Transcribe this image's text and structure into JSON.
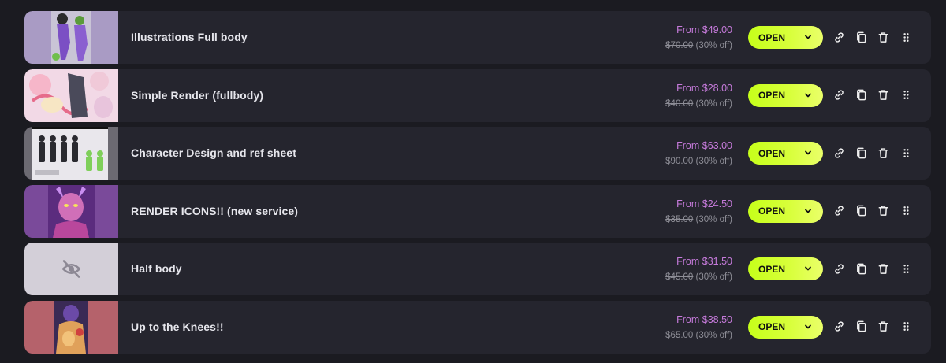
{
  "services": [
    {
      "title": "Illustrations Full body",
      "price_from": "From $49.00",
      "price_original": "$70.00",
      "discount": "(30% off)",
      "status": "OPEN",
      "thumbnail": "illustration-fullbody",
      "thumb_bg": "#a99bc4"
    },
    {
      "title": "Simple Render (fullbody)",
      "price_from": "From $28.00",
      "price_original": "$40.00",
      "discount": "(30% off)",
      "status": "OPEN",
      "thumbnail": "simple-render",
      "thumb_bg": "#f2d9e6"
    },
    {
      "title": "Character Design and ref sheet",
      "price_from": "From $63.00",
      "price_original": "$90.00",
      "discount": "(30% off)",
      "status": "OPEN",
      "thumbnail": "character-sheet",
      "thumb_bg": "#d8d6dd"
    },
    {
      "title": "RENDER ICONS!! (new service)",
      "price_from": "From $24.50",
      "price_original": "$35.00",
      "discount": "(30% off)",
      "status": "OPEN",
      "thumbnail": "render-icon",
      "thumb_bg": "#7a4a9a"
    },
    {
      "title": "Half body",
      "price_from": "From $31.50",
      "price_original": "$45.00",
      "discount": "(30% off)",
      "status": "OPEN",
      "thumbnail": "hidden-eye-icon",
      "thumb_bg": "#d3cfd8"
    },
    {
      "title": "Up to the Knees!!",
      "price_from": "From $38.50",
      "price_original": "$65.00",
      "discount": "(30% off)",
      "status": "OPEN",
      "thumbnail": "knees-render",
      "thumb_bg": "#b5626b"
    }
  ],
  "actions": {
    "link_icon": "link-icon",
    "copy_icon": "copy-icon",
    "delete_icon": "trash-icon",
    "drag_icon": "drag-handle-icon"
  },
  "colors": {
    "page_bg": "#1b1b21",
    "row_bg": "#25252e",
    "price_accent": "#c77bdc",
    "button_accent": "#c6ff1a"
  }
}
